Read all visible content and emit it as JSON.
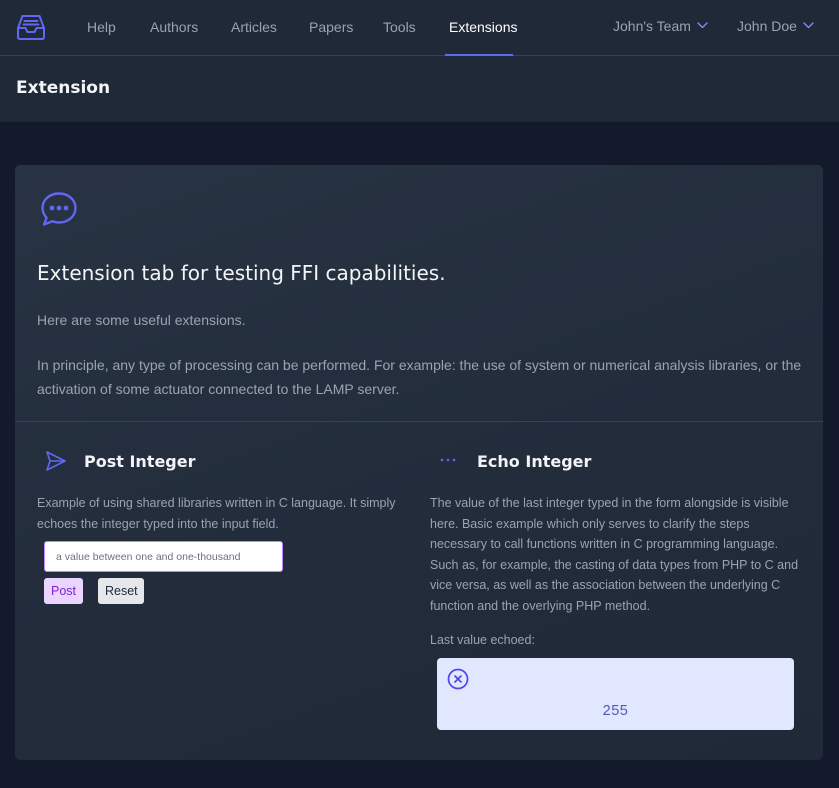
{
  "nav": {
    "links": [
      "Help",
      "Authors",
      "Articles",
      "Papers",
      "Tools",
      "Extensions"
    ],
    "active": "Extensions",
    "team": "John's Team",
    "user": "John Doe"
  },
  "page": {
    "title": "Extension"
  },
  "card": {
    "icon": "chat-bubble-ellipsis-icon",
    "title": "Extension tab for testing FFI capabilities.",
    "p1": "Here are some useful extensions.",
    "p2": "In principle, any type of processing can be performed. For example: the use of system or numerical analysis libraries, or the activation of some actuator connected to the LAMP server."
  },
  "post": {
    "icon": "send-icon",
    "title": "Post Integer",
    "desc": "Example of using shared libraries written in C language. It simply echoes the integer typed into the input field.",
    "input_value": "",
    "input_placeholder": "a value between one and one-thousand",
    "post_label": "Post",
    "reset_label": "Reset"
  },
  "echo": {
    "icon": "ellipsis-icon",
    "title": "Echo Integer",
    "desc": "The value of the last integer typed in the form alongside is visible here. Basic example which only serves to clarify the steps necessary to call functions written in C programming language. Such as, for example, the casting of data types from PHP to C and vice versa, as well as the association between the underlying C function and the overlying PHP method.",
    "last_label": "Last value echoed:",
    "value": "255",
    "close_icon": "close-circle-icon"
  },
  "colors": {
    "accent": "#6366f1",
    "nav_bg": "#1f2937",
    "page_bg": "#121a2b",
    "echo_bg": "#e0e7ff",
    "post_button_bg": "#e9d5ff"
  }
}
